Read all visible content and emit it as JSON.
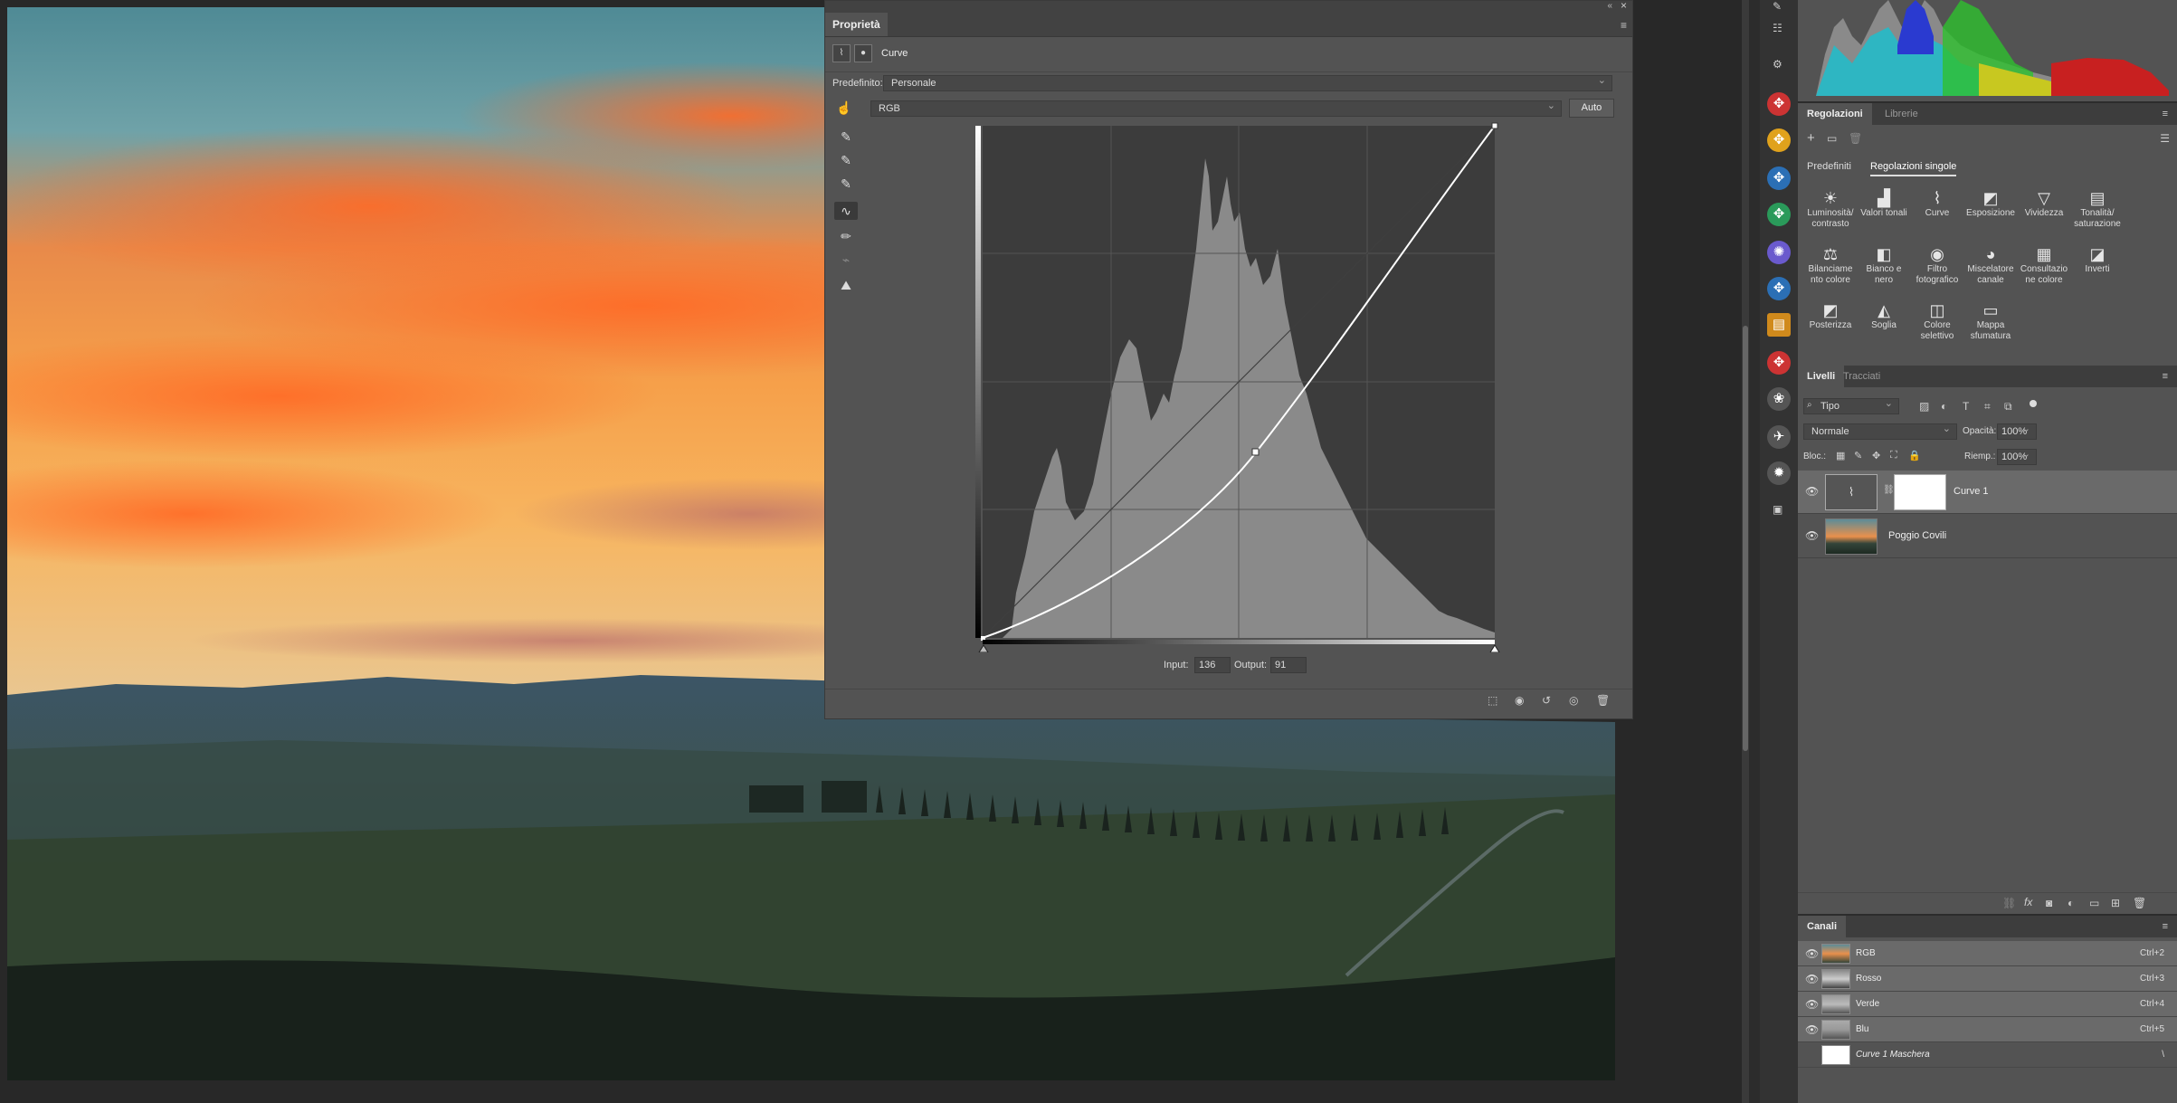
{
  "properties": {
    "tab_label": "Proprietà",
    "adjustment_name": "Curve",
    "preset_label": "Predefinito:",
    "preset_value": "Personale",
    "channel_value": "RGB",
    "auto_label": "Auto",
    "input_label": "Input:",
    "input_value": "136",
    "output_label": "Output:",
    "output_value": "91"
  },
  "adjustments_panel": {
    "tabs": [
      "Regolazioni",
      "Librerie"
    ],
    "subtabs": [
      "Predefiniti",
      "Regolazioni singole"
    ],
    "items": [
      {
        "label": "Luminosità/ contrasto",
        "icon": "brightness-icon"
      },
      {
        "label": "Valori tonali",
        "icon": "levels-icon"
      },
      {
        "label": "Curve",
        "icon": "curves-icon"
      },
      {
        "label": "Esposizione",
        "icon": "exposure-icon"
      },
      {
        "label": "Vividezza",
        "icon": "vibrance-icon"
      },
      {
        "label": "Tonalità/ saturazione",
        "icon": "hue-saturation-icon"
      },
      {
        "label": "Bilanciame nto colore",
        "icon": "color-balance-icon"
      },
      {
        "label": "Bianco e nero",
        "icon": "black-white-icon"
      },
      {
        "label": "Filtro fotografico",
        "icon": "photo-filter-icon"
      },
      {
        "label": "Miscelatore canale",
        "icon": "channel-mixer-icon"
      },
      {
        "label": "Consultazio ne colore",
        "icon": "color-lookup-icon"
      },
      {
        "label": "Inverti",
        "icon": "invert-icon"
      },
      {
        "label": "Posterizza",
        "icon": "posterize-icon"
      },
      {
        "label": "Soglia",
        "icon": "threshold-icon"
      },
      {
        "label": "Colore selettivo",
        "icon": "selective-color-icon"
      },
      {
        "label": "Mappa sfumatura",
        "icon": "gradient-map-icon"
      }
    ]
  },
  "layers_panel": {
    "tabs": [
      "Livelli",
      "Tracciati"
    ],
    "filter_value": "Tipo",
    "blend_mode": "Normale",
    "opacity_label": "Opacità:",
    "opacity_value": "100%",
    "lock_label": "Bloc.:",
    "fill_label": "Riemp.:",
    "fill_value": "100%",
    "layers": [
      {
        "name": "Curve 1"
      },
      {
        "name": "Poggio Covili"
      }
    ]
  },
  "channels_panel": {
    "tab": "Canali",
    "channels": [
      {
        "name": "RGB",
        "shortcut": "Ctrl+2"
      },
      {
        "name": "Rosso",
        "shortcut": "Ctrl+3"
      },
      {
        "name": "Verde",
        "shortcut": "Ctrl+4"
      },
      {
        "name": "Blu",
        "shortcut": "Ctrl+5"
      },
      {
        "name": "Curve 1 Maschera",
        "shortcut": "\\"
      }
    ]
  }
}
